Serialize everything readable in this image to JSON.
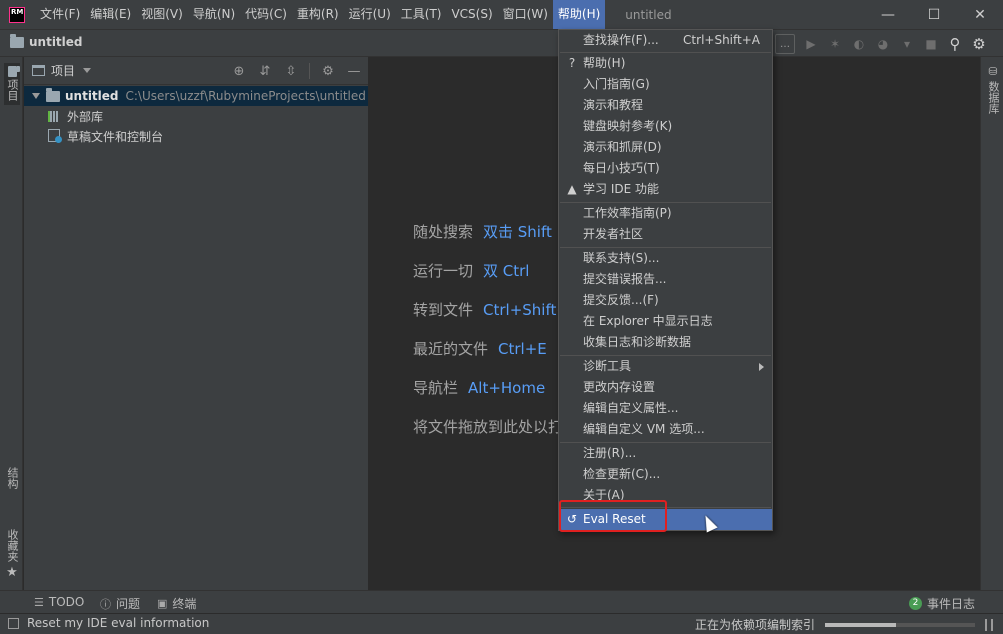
{
  "app": {
    "logo": "RM",
    "window_title": "untitled"
  },
  "menubar": {
    "items": [
      "文件(F)",
      "编辑(E)",
      "视图(V)",
      "导航(N)",
      "代码(C)",
      "重构(R)",
      "运行(U)",
      "工具(T)",
      "VCS(S)",
      "窗口(W)",
      "帮助(H)"
    ],
    "active_index": 10
  },
  "navbar": {
    "crumb": "untitled"
  },
  "left_stripe": {
    "top_tab": "项目",
    "structure_tab": "结构",
    "favorites_tab": "收藏夹"
  },
  "right_stripe": {
    "tab": "数据库"
  },
  "project_panel": {
    "title": "项目",
    "tree": {
      "root_name": "untitled",
      "root_path": "C:\\Users\\uzzf\\RubymineProjects\\untitled",
      "external_libs": "外部库",
      "scratches": "草稿文件和控制台"
    }
  },
  "editor": {
    "hints": [
      {
        "label": "随处搜索",
        "key": "双击 Shift"
      },
      {
        "label": "运行一切",
        "key": "双 Ctrl"
      },
      {
        "label": "转到文件",
        "key": "Ctrl+Shift+N"
      },
      {
        "label": "最近的文件",
        "key": "Ctrl+E"
      },
      {
        "label": "导航栏",
        "key": "Alt+Home"
      },
      {
        "label": "将文件拖放到此处以打开",
        "key": ""
      }
    ]
  },
  "help_menu": {
    "find_action": "查找操作(F)...",
    "find_action_shortcut": "Ctrl+Shift+A",
    "help": "帮助(H)",
    "getting_started": "入门指南(G)",
    "demos": "演示和教程",
    "keymap_ref": "键盘映射参考(K)",
    "demo_capture": "演示和抓屏(D)",
    "tip_of_day": "每日小技巧(T)",
    "learn_ide": "学习 IDE 功能",
    "productivity": "工作效率指南(P)",
    "community": "开发者社区",
    "contact_support": "联系支持(S)...",
    "submit_bug": "提交错误报告...",
    "submit_feedback": "提交反馈...(F)",
    "show_log": "在 Explorer 中显示日志",
    "collect_logs": "收集日志和诊断数据",
    "diagnostic_tools": "诊断工具",
    "change_memory": "更改内存设置",
    "edit_props": "编辑自定义属性...",
    "edit_vm": "编辑自定义 VM 选项...",
    "register": "注册(R)...",
    "check_updates": "检查更新(C)...",
    "about": "关于(A)",
    "eval_reset": "Eval Reset"
  },
  "bottom_tabs": {
    "todo": "TODO",
    "problems": "问题",
    "terminal": "终端",
    "event_log": "事件日志",
    "event_count": "2"
  },
  "status": {
    "message": "Reset my IDE eval information",
    "indexing": "正在为依赖项编制索引",
    "progress": 0.47
  }
}
